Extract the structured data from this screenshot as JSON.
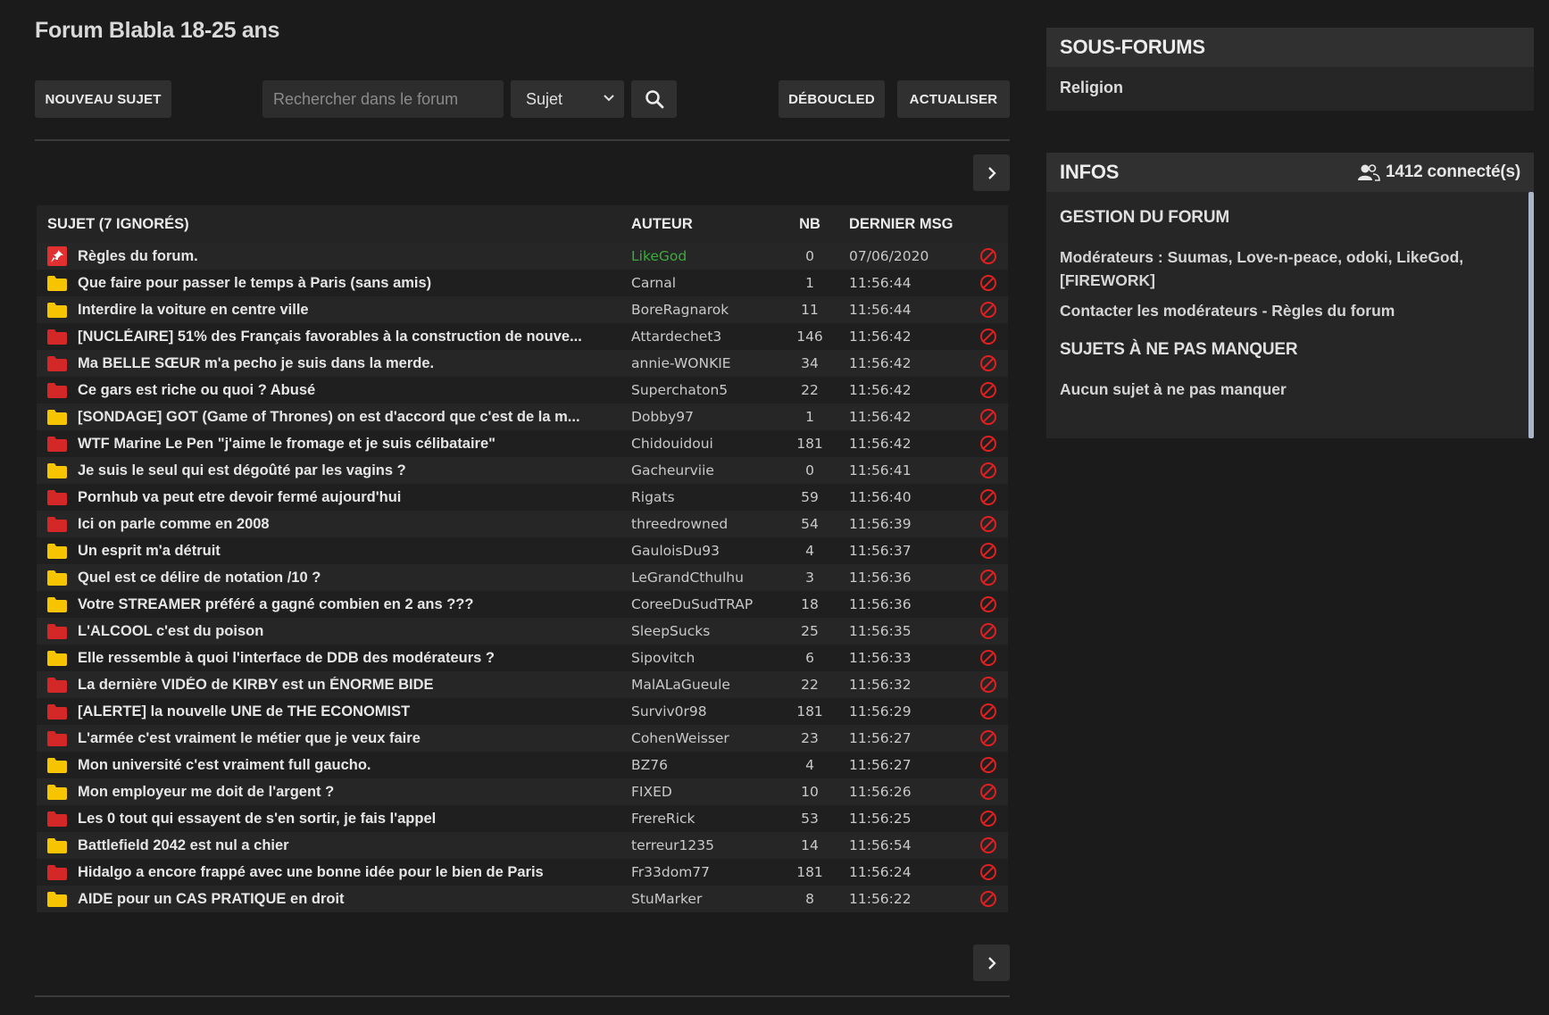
{
  "forum_title": "Forum Blabla 18-25 ans",
  "toolbar": {
    "new_topic": "NOUVEAU SUJET",
    "search_placeholder": "Rechercher dans le forum",
    "search_scope": "Sujet",
    "deboucled": "DÉBOUCLED",
    "refresh": "ACTUALISER"
  },
  "table": {
    "headers": {
      "subject": "SUJET (7 IGNORÉS)",
      "author": "AUTEUR",
      "nb": "NB",
      "last": "DERNIER MSG"
    },
    "rows": [
      {
        "icon": "pinned",
        "title": "Règles du forum.",
        "author": "LikeGod",
        "nb": "0",
        "last": "07/06/2020"
      },
      {
        "icon": "folder-yellow",
        "title": "Que faire pour passer le temps à Paris (sans amis)",
        "author": "Carnal",
        "nb": "1",
        "last": "11:56:44"
      },
      {
        "icon": "folder-yellow",
        "title": "Interdire la voiture en centre ville",
        "author": "BoreRagnarok",
        "nb": "11",
        "last": "11:56:44"
      },
      {
        "icon": "folder-red",
        "title": "[NUCLÉAIRE] 51% des Français favorables à la construction de nouve...",
        "author": "Attardechet3",
        "nb": "146",
        "last": "11:56:42"
      },
      {
        "icon": "folder-red",
        "title": "Ma BELLE SŒUR m'a pecho je suis dans la merde.",
        "author": "annie-WONKIE",
        "nb": "34",
        "last": "11:56:42"
      },
      {
        "icon": "folder-red",
        "title": "Ce gars est riche ou quoi ? Abusé",
        "author": "Superchaton5",
        "nb": "22",
        "last": "11:56:42"
      },
      {
        "icon": "folder-yellow",
        "title": "[SONDAGE] GOT (Game of Thrones) on est d'accord que c'est de la m...",
        "author": "Dobby97",
        "nb": "1",
        "last": "11:56:42"
      },
      {
        "icon": "folder-red",
        "title": "WTF Marine Le Pen \"j'aime le fromage et je suis célibataire\"",
        "author": "Chidouidoui",
        "nb": "181",
        "last": "11:56:42"
      },
      {
        "icon": "folder-yellow",
        "title": "Je suis le seul qui est dégoûté par les vagins ?",
        "author": "Gacheurviie",
        "nb": "0",
        "last": "11:56:41"
      },
      {
        "icon": "folder-red",
        "title": "Pornhub va peut etre devoir fermé aujourd'hui",
        "author": "Rigats",
        "nb": "59",
        "last": "11:56:40"
      },
      {
        "icon": "folder-red",
        "title": "Ici on parle comme en 2008",
        "author": "threedrowned",
        "nb": "54",
        "last": "11:56:39"
      },
      {
        "icon": "folder-yellow",
        "title": "Un esprit m'a détruit",
        "author": "GauloisDu93",
        "nb": "4",
        "last": "11:56:37"
      },
      {
        "icon": "folder-yellow",
        "title": "Quel est ce délire de notation /10 ?",
        "author": "LeGrandCthulhu",
        "nb": "3",
        "last": "11:56:36"
      },
      {
        "icon": "folder-yellow",
        "title": "Votre STREAMER préféré a gagné combien en 2 ans ???",
        "author": "CoreeDuSudTRAP",
        "nb": "18",
        "last": "11:56:36"
      },
      {
        "icon": "folder-red",
        "title": "L'ALCOOL c'est du poison",
        "author": "SleepSucks",
        "nb": "25",
        "last": "11:56:35"
      },
      {
        "icon": "folder-yellow",
        "title": "Elle ressemble à quoi l'interface de DDB des modérateurs ?",
        "author": "Sipovitch",
        "nb": "6",
        "last": "11:56:33"
      },
      {
        "icon": "folder-red",
        "title": "La dernière VIDÉO de KIRBY est un ÉNORME BIDE",
        "author": "MalALaGueule",
        "nb": "22",
        "last": "11:56:32"
      },
      {
        "icon": "folder-red",
        "title": "[ALERTE] la nouvelle UNE de THE ECONOMIST",
        "author": "Surviv0r98",
        "nb": "181",
        "last": "11:56:29"
      },
      {
        "icon": "folder-red",
        "title": "L'armée c'est vraiment le métier que je veux faire",
        "author": "CohenWeisser",
        "nb": "23",
        "last": "11:56:27"
      },
      {
        "icon": "folder-yellow",
        "title": "Mon université c'est vraiment full gaucho.",
        "author": "BZ76",
        "nb": "4",
        "last": "11:56:27"
      },
      {
        "icon": "folder-yellow",
        "title": "Mon employeur me doit de l'argent ?",
        "author": "FIXED",
        "nb": "10",
        "last": "11:56:26"
      },
      {
        "icon": "folder-red",
        "title": "Les 0 tout qui essayent de s'en sortir, je fais l'appel",
        "author": "FrereRick",
        "nb": "53",
        "last": "11:56:25"
      },
      {
        "icon": "folder-yellow",
        "title": "Battlefield 2042 est nul a chier",
        "author": "terreur1235",
        "nb": "14",
        "last": "11:56:54"
      },
      {
        "icon": "folder-red",
        "title": "Hidalgo a encore frappé avec une bonne idée pour le bien de Paris",
        "author": "Fr33dom77",
        "nb": "181",
        "last": "11:56:24"
      },
      {
        "icon": "folder-yellow",
        "title": "AIDE pour un CAS PRATIQUE en droit",
        "author": "StuMarker",
        "nb": "8",
        "last": "11:56:22"
      }
    ]
  },
  "sidebar": {
    "subforums_title": "SOUS-FORUMS",
    "subforums": [
      "Religion"
    ],
    "infos_title": "INFOS",
    "online_count": "1412 connecté(s)",
    "gestion_title": "GESTION DU FORUM",
    "moderators_text": "Modérateurs : Suumas, Love-n-peace, odoki, LikeGod, [FIREWORK]",
    "contact_text": "Contacter les modérateurs - Règles du forum",
    "must_read_title": "SUJETS À NE PAS MANQUER",
    "must_read_text": "Aucun sujet à ne pas manquer"
  },
  "colors": {
    "folder_yellow": "#f7c400",
    "folder_red": "#d42828",
    "pinned_red": "#e03030",
    "block_red": "#e02020",
    "author_highlight": "#3cab3c"
  }
}
